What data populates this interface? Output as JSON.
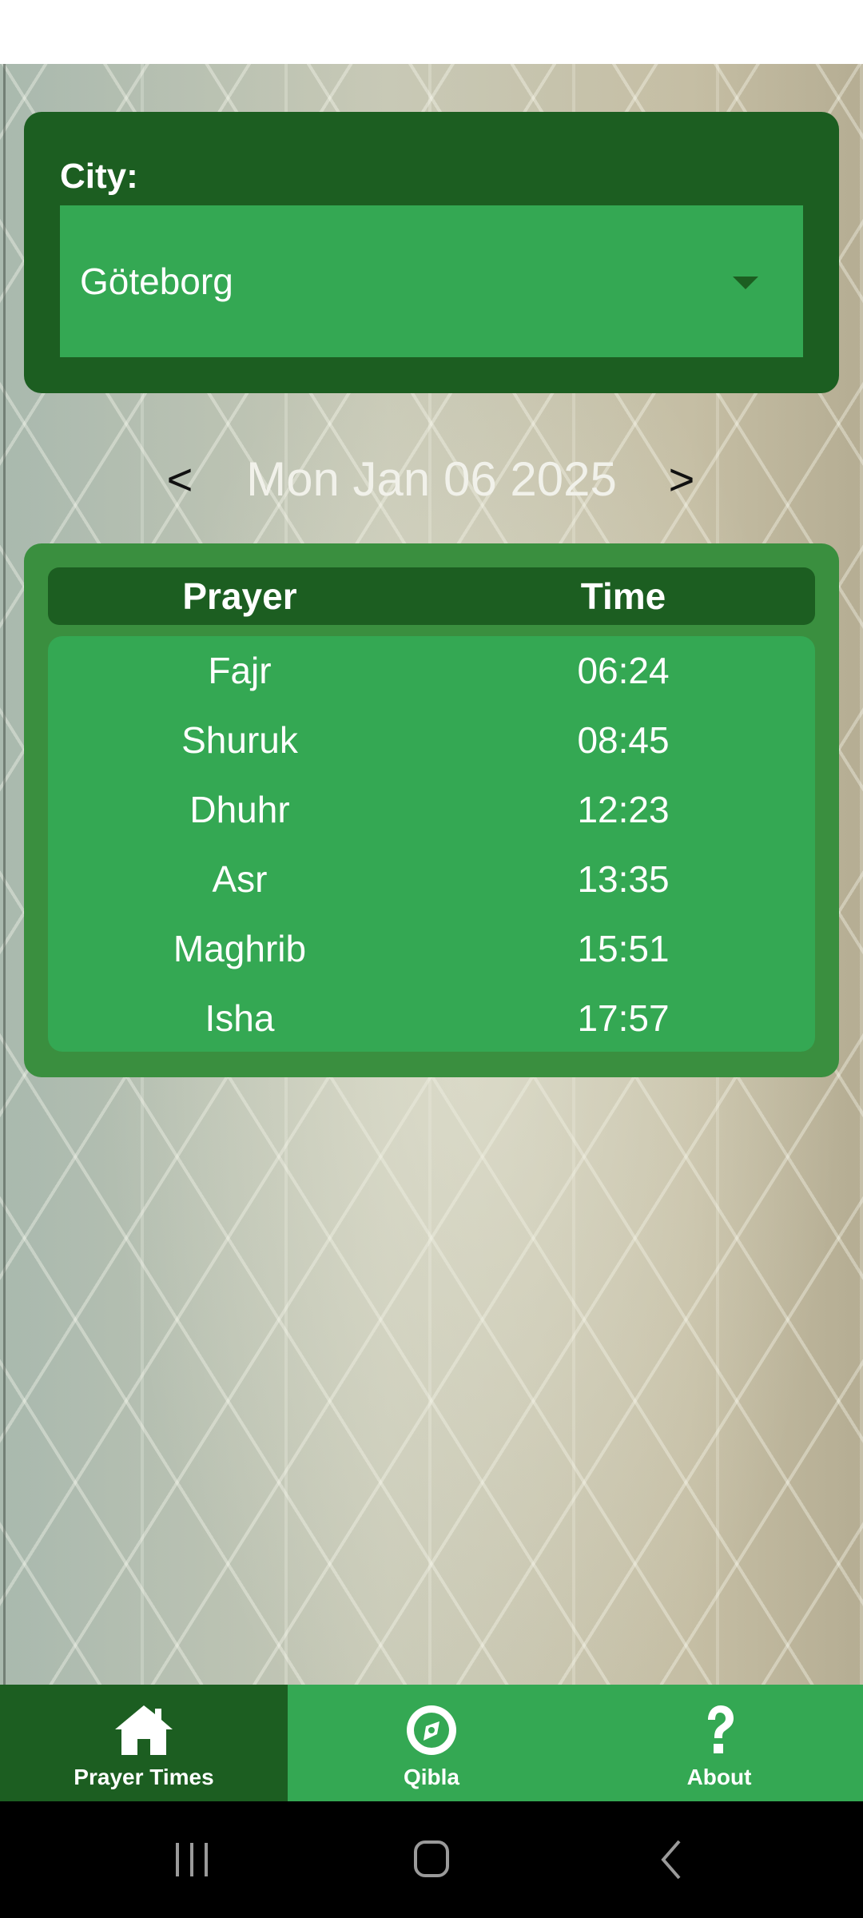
{
  "city": {
    "label": "City:",
    "selected": "Göteborg"
  },
  "date": {
    "prev_label": "<",
    "current": "Mon Jan 06 2025",
    "next_label": ">"
  },
  "table": {
    "headers": [
      "Prayer",
      "Time"
    ],
    "rows": [
      {
        "prayer": "Fajr",
        "time": "06:24"
      },
      {
        "prayer": "Shuruk",
        "time": "08:45"
      },
      {
        "prayer": "Dhuhr",
        "time": "12:23"
      },
      {
        "prayer": "Asr",
        "time": "13:35"
      },
      {
        "prayer": "Maghrib",
        "time": "15:51"
      },
      {
        "prayer": "Isha",
        "time": "17:57"
      }
    ]
  },
  "bottom_nav": {
    "items": [
      {
        "label": "Prayer Times",
        "icon": "home-icon",
        "active": true
      },
      {
        "label": "Qibla",
        "icon": "compass-icon",
        "active": false
      },
      {
        "label": "About",
        "icon": "question-icon",
        "active": false
      }
    ]
  },
  "colors": {
    "dark_green": "#1c5e21",
    "medium_green": "#3a8f3f",
    "bright_green": "#34a853"
  }
}
